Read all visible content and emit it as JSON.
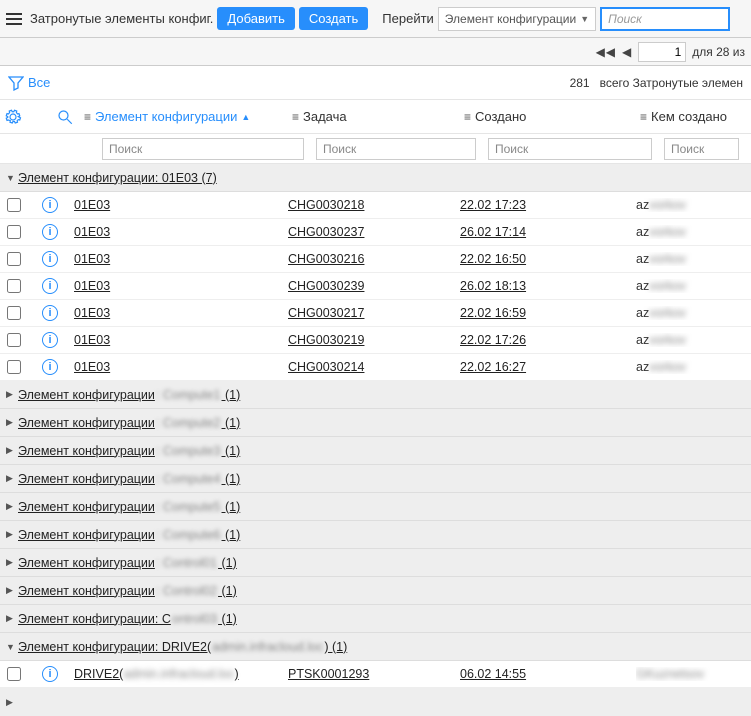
{
  "header": {
    "title": "Затронутые элементы конфиг.",
    "add_label": "Добавить",
    "create_label": "Создать",
    "goto_label": "Перейти",
    "goto_select": "Элемент конфигурации",
    "search_placeholder": "Поиск"
  },
  "pager": {
    "page_value": "1",
    "total_text": "для 28 из"
  },
  "toolbar": {
    "filter_all": "Все",
    "summary_count": "281",
    "summary_text": "всего Затронутые элемен"
  },
  "columns": {
    "ci": "Элемент конфигурации",
    "task": "Задача",
    "created": "Создано",
    "by": "Кем создано"
  },
  "filters": {
    "placeholder": "Поиск"
  },
  "group_open": {
    "label": "Элемент конфигурации: 01E03 (7)"
  },
  "rows": [
    {
      "ci": "01E03",
      "task": "CHG0030218",
      "created": "22.02 17:23",
      "by_prefix": "az",
      "by_blurred": "vorkov"
    },
    {
      "ci": "01E03",
      "task": "CHG0030237",
      "created": "26.02 17:14",
      "by_prefix": "az",
      "by_blurred": "vorkov"
    },
    {
      "ci": "01E03",
      "task": "CHG0030216",
      "created": "22.02 16:50",
      "by_prefix": "az",
      "by_blurred": "vorkov"
    },
    {
      "ci": "01E03",
      "task": "CHG0030239",
      "created": "26.02 18:13",
      "by_prefix": "az",
      "by_blurred": "vorkov"
    },
    {
      "ci": "01E03",
      "task": "CHG0030217",
      "created": "22.02 16:59",
      "by_prefix": "az",
      "by_blurred": "vorkov"
    },
    {
      "ci": "01E03",
      "task": "CHG0030219",
      "created": "22.02 17:26",
      "by_prefix": "az",
      "by_blurred": "vorkov"
    },
    {
      "ci": "01E03",
      "task": "CHG0030214",
      "created": "22.02 16:27",
      "by_prefix": "az",
      "by_blurred": "vorkov"
    }
  ],
  "groups_collapsed": [
    {
      "prefix": "Элемент конфигурации",
      "blurred": ": Compute1",
      "suffix": " (1)"
    },
    {
      "prefix": "Элемент конфигурации",
      "blurred": ": Compute2",
      "suffix": " (1)"
    },
    {
      "prefix": "Элемент конфигурации",
      "blurred": ": Compute3",
      "suffix": " (1)"
    },
    {
      "prefix": "Элемент конфигурации",
      "blurred": ": Compute4",
      "suffix": " (1)"
    },
    {
      "prefix": "Элемент конфигурации",
      "blurred": ": Compute5",
      "suffix": " (1)"
    },
    {
      "prefix": "Элемент конфигурации",
      "blurred": ": Compute6",
      "suffix": " (1)"
    },
    {
      "prefix": "Элемент конфигурации",
      "blurred": ": Control01",
      "suffix": " (1)"
    },
    {
      "prefix": "Элемент конфигурации",
      "blurred": ": Control02",
      "suffix": " (1)"
    },
    {
      "prefix": "Элемент конфигурации: C",
      "blurred": "ontrol03",
      "suffix": " (1)"
    }
  ],
  "group_drive": {
    "prefix": "Элемент конфигурации: DRIVE2(",
    "blurred": " admin.infracloud.loc",
    "suffix": ") (1)"
  },
  "drive_row": {
    "ci_prefix": "DRIVE2(",
    "ci_blurred": " admin.infracloud.loc",
    "ci_suffix": ")",
    "task": "PTSK0001293",
    "created": "06.02 14:55",
    "by_blurred": "GKuznetsov"
  }
}
